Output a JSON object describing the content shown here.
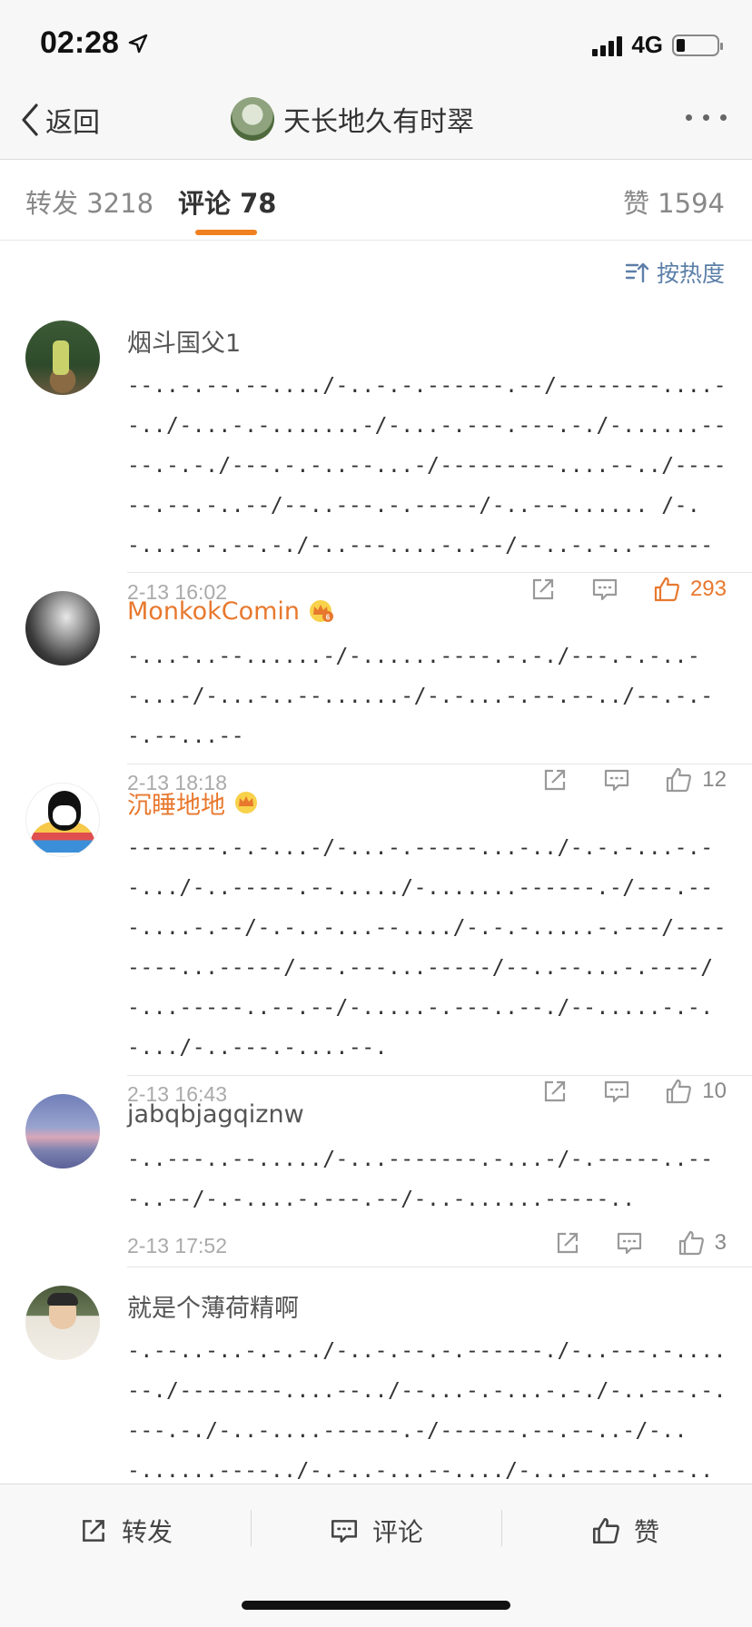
{
  "status_bar": {
    "time": "02:28",
    "network": "4G"
  },
  "nav": {
    "back_label": "返回",
    "title": "天长地久有时翠"
  },
  "tabs": [
    {
      "label": "转发 3218"
    },
    {
      "label": "评论 78"
    },
    {
      "label": "赞 1594"
    }
  ],
  "sort_label": "按热度",
  "comments": [
    {
      "name": "烟斗国父1",
      "vip": false,
      "text": "--..-.--.--..../-..-.-.------.--/--------....--../-...-.-.......-/-...-.---.---.-./-......----.-.-./---.-.-..--...-/---------....--../------.--.-..--/--..---.-.-----/-..---...... /-.-...-.-.--.-./-..---....-..--/--..-.-..------",
      "time": "2-13 16:02",
      "likes": "293",
      "hot": true
    },
    {
      "name": "MonkokComin",
      "vip": true,
      "text": "-...-..--......-/-......----.-.-./---.-.-..--...-/-...-..--......-/-.-...-.--.--../--.-.--.--...--",
      "time": "2-13 18:18",
      "likes": "12",
      "hot": false
    },
    {
      "name": "沉睡地地",
      "vip": true,
      "text": "-------.-.-...-/-...-.-----...-../-.-.-...-.--.../-..-----.--...../-.......------.-/---.---....-.--/-.-..-...--..../-.-.-.....-.---/--------...-----/---.---...-----/--..--...-.----/-...-----..--.--/-.....-.---..--./--.....-.-.-.../-..---.-....--.",
      "time": "2-13 16:43",
      "likes": "10",
      "hot": false
    },
    {
      "name": "jabqbjagqiznw",
      "vip": false,
      "text": "-..---..--...../-...-------.-...-/-.-----..---..--/-.-....-.---.--/-..-......-----..",
      "time": "2-13 17:52",
      "likes": "3",
      "hot": false
    },
    {
      "name": "就是个薄荷精啊",
      "vip": false,
      "text": "-.--..-..-.-.-./-..-.--.-.------./-..---.-....--./--------....--../--...-.-...-.-./-..---.-.---.-./-..-....------.-/------.--.--..-/-..-......----../-.-..-...--..../-...------.--..-/----..---..--.-/-.-.---..--..../--.-.--.--..-.-/--..",
      "time": "",
      "likes": "",
      "hot": false
    }
  ],
  "bottom_bar": {
    "repost_label": "转发",
    "comment_label": "评论",
    "like_label": "赞"
  },
  "colors": {
    "accent": "#f08020",
    "vip_name": "#e8782e",
    "link_blue": "#5c7fa8"
  }
}
